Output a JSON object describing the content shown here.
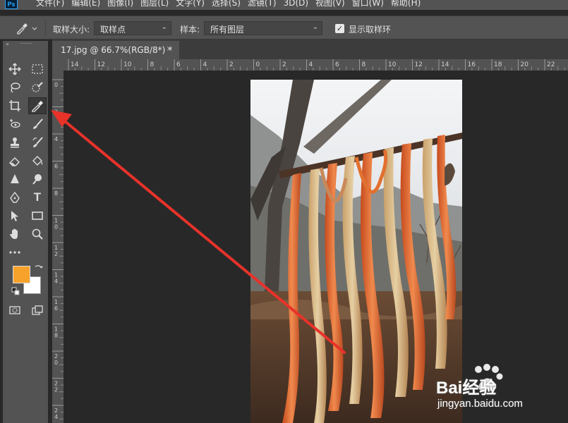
{
  "app": {
    "logo_text": "Ps"
  },
  "menu": [
    "文件(F)",
    "编辑(E)",
    "图像(I)",
    "图层(L)",
    "文字(Y)",
    "选择(S)",
    "滤镜(T)",
    "3D(D)",
    "视图(V)",
    "窗口(W)",
    "帮助(H)"
  ],
  "options": {
    "sample_size_label": "取样大小:",
    "sample_size_value": "取样点",
    "sample_label": "样本:",
    "sample_value": "所有图层",
    "show_ring_label": "显示取样环",
    "show_ring_checked": true
  },
  "document": {
    "tab_title": "17.jpg @ 66.7%(RGB/8*) *",
    "close_symbol": "×"
  },
  "rulers": {
    "horizontal": [
      "14",
      "12",
      "10",
      "8",
      "6",
      "4",
      "2",
      "0",
      "2",
      "4",
      "6",
      "8",
      "10",
      "12",
      "14",
      "16",
      "18",
      "20",
      "22"
    ],
    "vertical": [
      "0",
      "2",
      "4",
      "6",
      "8",
      "1\n0",
      "1\n2",
      "1\n4",
      "1\n6",
      "1\n8",
      "2\n0",
      "2\n2",
      "2\n4"
    ]
  },
  "toolbar": {
    "tools": [
      "move-icon",
      "marquee-icon",
      "lasso-icon",
      "quick-select-icon",
      "crop-icon",
      "eyedropper-icon",
      "healing-icon",
      "brush-icon",
      "stamp-icon",
      "history-brush-icon",
      "eraser-icon",
      "paint-bucket-icon",
      "blur-icon",
      "dodge-icon",
      "pen-icon",
      "type-icon",
      "path-select-icon",
      "rectangle-icon",
      "hand-icon",
      "zoom-icon",
      "more-tools-icon"
    ],
    "foreground_color": "#f7a22b",
    "background_color": "#ffffff",
    "type_glyph": "T"
  },
  "watermark": {
    "brand": "Bai经验",
    "url": "jingyan.baidu.com"
  },
  "annotation": {
    "arrow_color": "#e8322a"
  }
}
